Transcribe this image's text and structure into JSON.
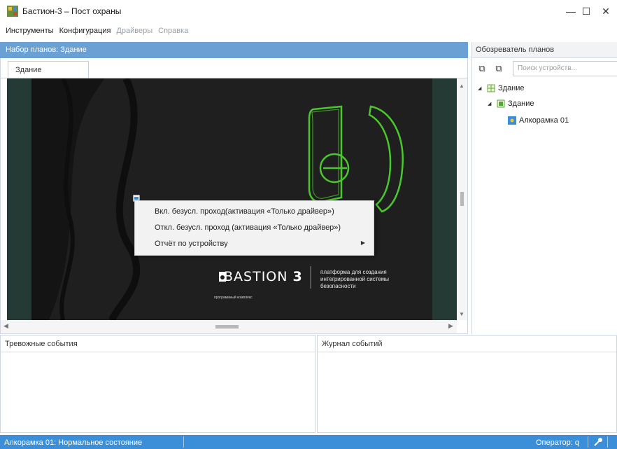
{
  "window": {
    "title": "Бастион-3 – Пост охраны",
    "controls": {
      "minimize": "—",
      "maximize": "☐",
      "close": "✕"
    }
  },
  "menu": [
    {
      "label": "Инструменты",
      "enabled": true
    },
    {
      "label": "Конфигурация",
      "enabled": true
    },
    {
      "label": "Драйверы",
      "enabled": false
    },
    {
      "label": "Справка",
      "enabled": false
    }
  ],
  "plans_panel": {
    "header": "Набор планов: Здание",
    "tab": "Здание",
    "device_marker": "device-icon"
  },
  "logo": {
    "wordmark": "BASTION",
    "version": "3",
    "subline": "программный комплекс",
    "slogan": "платформа для создания\nинтегрированной системы\nбезопасности"
  },
  "context_menu": {
    "items": [
      {
        "label": "Вкл. безусл. проход(активация «Только драйвер»)",
        "submenu": false
      },
      {
        "label": "Откл. безусл. проход (активация «Только драйвер»)",
        "submenu": false
      },
      {
        "label": "Отчёт по устройству",
        "submenu": true
      }
    ]
  },
  "explorer": {
    "header": "Обозреватель планов",
    "search_placeholder": "Поиск устройств...",
    "tree": [
      {
        "label": "Здание",
        "level": 0,
        "icon": "building-icon"
      },
      {
        "label": "Здание",
        "level": 1,
        "icon": "plan-icon"
      },
      {
        "label": "Алкорамка 01",
        "level": 2,
        "icon": "device-icon"
      }
    ]
  },
  "alarm_panel": {
    "header": "Тревожные события"
  },
  "journal_panel": {
    "header": "Журнал событий"
  },
  "status": {
    "device_state": "Алкорамка 01: Нормальное состояние",
    "operator": "Оператор: q"
  },
  "colors": {
    "accent": "#3b8fd9",
    "panel_header": "#6aa0d4",
    "logo_green": "#4cc72b",
    "plan_bg": "#263a35"
  }
}
